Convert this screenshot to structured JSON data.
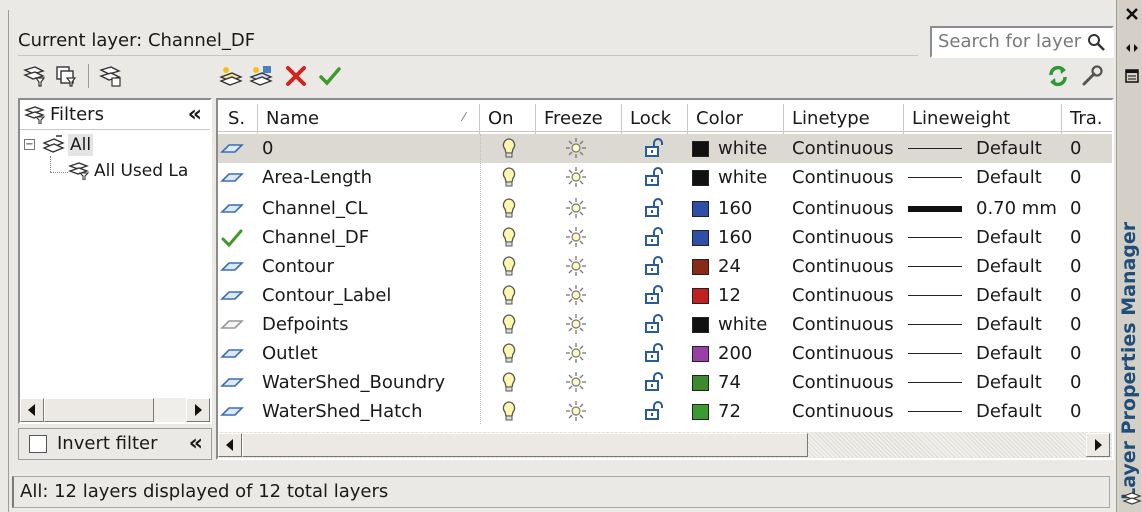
{
  "header": {
    "current_layer": "Current layer: Channel_DF",
    "search_placeholder": "Search for layer"
  },
  "filters": {
    "title": "Filters",
    "collapse": "«",
    "tree": [
      {
        "label": "All",
        "level": 0
      },
      {
        "label": "All Used La",
        "level": 1
      }
    ],
    "invert_label": "Invert filter",
    "invert_checked": false
  },
  "table": {
    "headers": {
      "status": "S.",
      "name": "Name",
      "on": "On",
      "freeze": "Freeze",
      "lock": "Lock",
      "color": "Color",
      "linetype": "Linetype",
      "lineweight": "Lineweight",
      "transparency": "Tra."
    },
    "rows": [
      {
        "status": "layer",
        "name": "0",
        "color_name": "white",
        "color_hex": "#111111",
        "linetype": "Continuous",
        "lineweight": "Default",
        "lw_style": "thin",
        "transparency": "0",
        "selected": true
      },
      {
        "status": "layer",
        "name": "Area-Length",
        "color_name": "white",
        "color_hex": "#111111",
        "linetype": "Continuous",
        "lineweight": "Default",
        "lw_style": "thin",
        "transparency": "0",
        "selected": false
      },
      {
        "status": "layer",
        "name": "Channel_CL",
        "color_name": "160",
        "color_hex": "#2e4fa8",
        "linetype": "Continuous",
        "lineweight": "0.70 mm",
        "lw_style": "thick",
        "transparency": "0",
        "selected": false
      },
      {
        "status": "current",
        "name": "Channel_DF",
        "color_name": "160",
        "color_hex": "#2e4fa8",
        "linetype": "Continuous",
        "lineweight": "Default",
        "lw_style": "thin",
        "transparency": "0",
        "selected": false
      },
      {
        "status": "layer",
        "name": "Contour",
        "color_name": "24",
        "color_hex": "#8a2a16",
        "linetype": "Continuous",
        "lineweight": "Default",
        "lw_style": "thin",
        "transparency": "0",
        "selected": false
      },
      {
        "status": "layer",
        "name": "Contour_Label",
        "color_name": "12",
        "color_hex": "#c0201e",
        "linetype": "Continuous",
        "lineweight": "Default",
        "lw_style": "thin",
        "transparency": "0",
        "selected": false
      },
      {
        "status": "unused",
        "name": "Defpoints",
        "color_name": "white",
        "color_hex": "#111111",
        "linetype": "Continuous",
        "lineweight": "Default",
        "lw_style": "thin",
        "transparency": "0",
        "selected": false
      },
      {
        "status": "layer",
        "name": "Outlet",
        "color_name": "200",
        "color_hex": "#9a3ea8",
        "linetype": "Continuous",
        "lineweight": "Default",
        "lw_style": "thin",
        "transparency": "0",
        "selected": false
      },
      {
        "status": "layer",
        "name": "WaterShed_Boundry",
        "color_name": "74",
        "color_hex": "#3c8a2e",
        "linetype": "Continuous",
        "lineweight": "Default",
        "lw_style": "thin",
        "transparency": "0",
        "selected": false
      },
      {
        "status": "layer",
        "name": "WaterShed_Hatch",
        "color_name": "72",
        "color_hex": "#3c9a30",
        "linetype": "Continuous",
        "lineweight": "Default",
        "lw_style": "thin",
        "transparency": "0",
        "selected": false
      }
    ]
  },
  "status_bar": {
    "text": "All: 12 layers displayed of 12 total layers"
  },
  "palette": {
    "title": "Layer Properties Manager"
  }
}
